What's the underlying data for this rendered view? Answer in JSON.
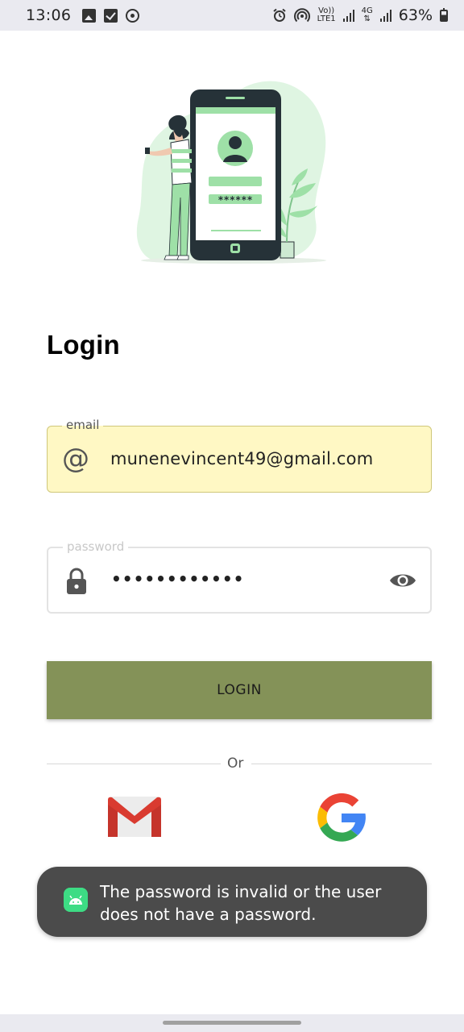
{
  "status_bar": {
    "time": "13:06",
    "volte_top": "Vo))",
    "volte_bottom": "LTE1",
    "network_type": "4G",
    "battery": "63%"
  },
  "icons": {
    "email": "at-sign-icon",
    "password": "lock-icon",
    "visibility": "eye-icon",
    "gmail": "gmail-icon",
    "google": "google-icon",
    "toast": "android-icon"
  },
  "login": {
    "title": "Login",
    "email": {
      "label": "email",
      "value": "munenevincent49@gmail.com"
    },
    "password": {
      "label": "password",
      "value": "••••••••••••"
    },
    "button_label": "LOGIN",
    "divider_text": "Or"
  },
  "illustration": {
    "masked_password": "******"
  },
  "toast": {
    "message": "The password is invalid or the user does not have a password."
  },
  "colors": {
    "email_field_bg": "#fff8c4",
    "login_button": "#849258",
    "illustration_accent": "#9ee0a7",
    "toast_bg": "#4b4b4b"
  }
}
